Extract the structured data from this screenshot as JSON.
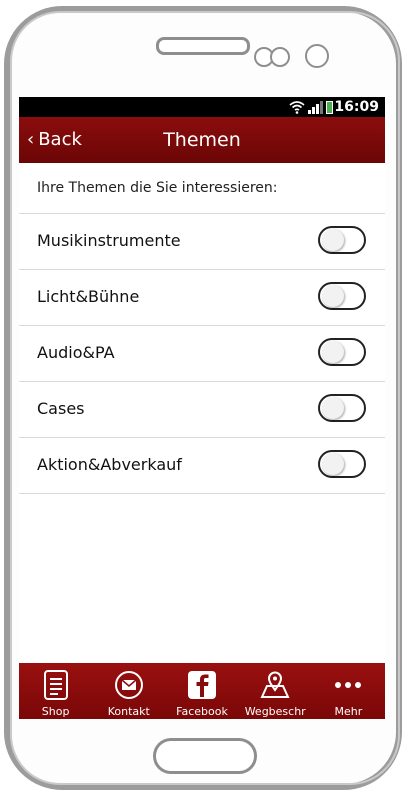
{
  "status": {
    "time": "16:09"
  },
  "header": {
    "back_label": "Back",
    "title": "Themen"
  },
  "content": {
    "intro": "Ihre Themen die Sie interessieren:",
    "topics": [
      {
        "label": "Musikinstrumente",
        "enabled": false
      },
      {
        "label": "Licht&Bühne",
        "enabled": false
      },
      {
        "label": "Audio&PA",
        "enabled": false
      },
      {
        "label": "Cases",
        "enabled": false
      },
      {
        "label": "Aktion&Abverkauf",
        "enabled": false
      }
    ]
  },
  "tabbar": {
    "tabs": [
      {
        "label": "Shop",
        "icon": "document-icon"
      },
      {
        "label": "Kontakt",
        "icon": "mail-icon"
      },
      {
        "label": "Facebook",
        "icon": "facebook-icon"
      },
      {
        "label": "Wegbeschr",
        "icon": "map-pin-icon"
      },
      {
        "label": "Mehr",
        "icon": "more-icon"
      }
    ]
  },
  "colors": {
    "accent": "#7a0707",
    "status_bar": "#000000",
    "battery": "#4caf50"
  }
}
